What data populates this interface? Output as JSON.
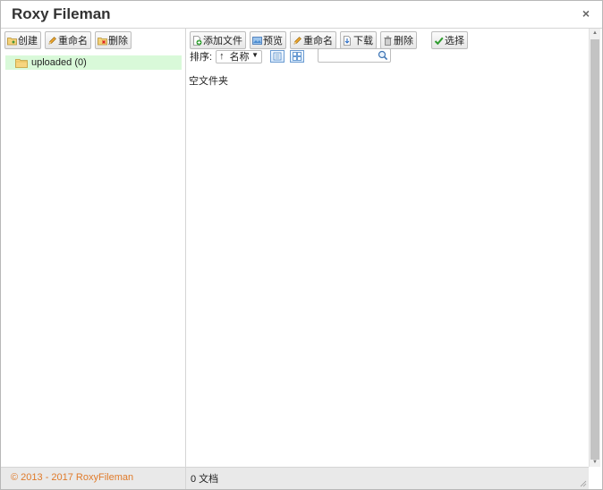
{
  "window": {
    "title": "Roxy Fileman",
    "close_glyph": "×"
  },
  "left_toolbar": {
    "create_label": "创建",
    "rename_label": "重命名",
    "delete_label": "删除"
  },
  "folder_tree": {
    "items": [
      {
        "label": "uploaded (0)",
        "icon": "folder-icon"
      }
    ]
  },
  "file_toolbar": {
    "add_file_label": "添加文件",
    "preview_label": "预览",
    "rename_label": "重命名",
    "download_label": "下载",
    "delete_label": "删除",
    "select_label": "选择"
  },
  "sort": {
    "label": "排序:",
    "direction_glyph": "↑",
    "selected": "名称",
    "dropdown_glyph": "▼"
  },
  "search": {
    "value": "",
    "placeholder": ""
  },
  "file_list": {
    "empty_text": "空文件夹"
  },
  "status": {
    "copyright": "© 2013 - 2017 RoxyFileman",
    "file_count": "0 文档"
  },
  "colors": {
    "tree_selected_bg": "#d9f9d9",
    "copyright": "#e07b2b",
    "view_button_border": "#6b9bd1"
  }
}
